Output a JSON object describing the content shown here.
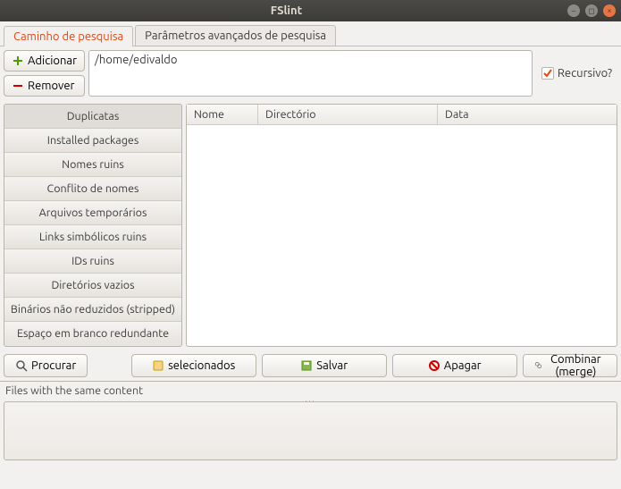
{
  "window": {
    "title": "FSlint"
  },
  "tabs": {
    "search_path": "Caminho de pesquisa",
    "advanced": "Parâmetros avançados de pesquisa"
  },
  "toolbar": {
    "add": "Adicionar",
    "remove": "Remover",
    "path": "/home/edivaldo",
    "recursive": "Recursivo?",
    "recursive_checked": true
  },
  "categories": [
    "Duplicatas",
    "Installed packages",
    "Nomes ruins",
    "Conflito de nomes",
    "Arquivos temporários",
    "Links simbólicos ruins",
    "IDs ruins",
    "Diretórios vazios",
    "Binários não reduzidos (stripped)",
    "Espaço em branco redundante"
  ],
  "columns": {
    "name": "Nome",
    "dir": "Directório",
    "date": "Data"
  },
  "actions": {
    "find": "Procurar",
    "selected": "selecionados",
    "save": "Salvar",
    "delete": "Apagar",
    "merge": "Combinar (merge)"
  },
  "status": "Files with the same content",
  "colors": {
    "accent": "#dd4814",
    "add_icon": "#4e9a06",
    "remove_icon": "#cc0000",
    "check_icon": "#dd4814"
  }
}
